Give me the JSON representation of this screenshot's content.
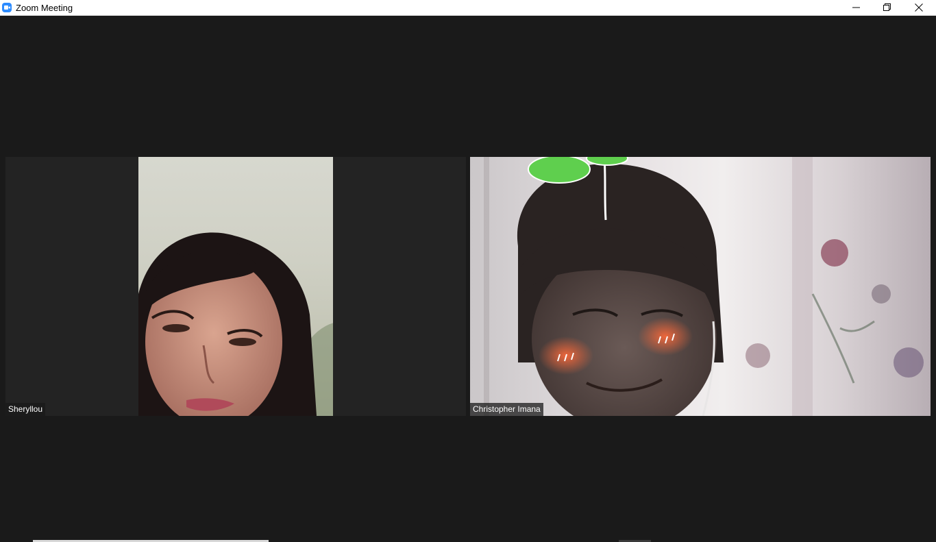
{
  "window": {
    "title": "Zoom Meeting",
    "icon": "zoom-camera-icon",
    "controls": {
      "minimize": "minimize-icon",
      "maximize": "restore-icon",
      "close": "close-icon"
    }
  },
  "participants": [
    {
      "name": "Sheryllou"
    },
    {
      "name": "Christopher Imana"
    }
  ],
  "colors": {
    "stage_background": "#1a1a1a",
    "tile_background": "#232323",
    "accent": "#2d8cff"
  }
}
